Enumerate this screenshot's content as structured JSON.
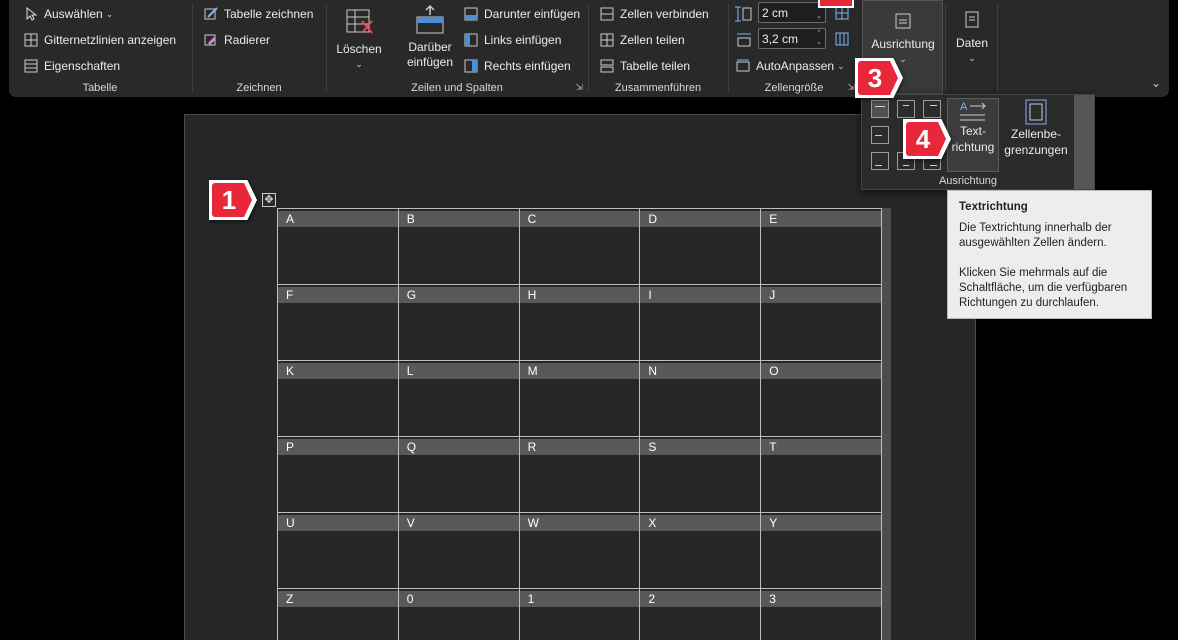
{
  "ribbon": {
    "tabelle": {
      "label": "Tabelle",
      "select": "Auswählen",
      "gridlines": "Gitternetzlinien anzeigen",
      "properties": "Eigenschaften"
    },
    "zeichnen": {
      "label": "Zeichnen",
      "draw_table": "Tabelle zeichnen",
      "eraser": "Radierer"
    },
    "zeilen_spalten": {
      "label": "Zeilen und Spalten",
      "delete": "Löschen",
      "insert_above_1": "Darüber",
      "insert_above_2": "einfügen",
      "insert_below": "Darunter einfügen",
      "insert_left": "Links einfügen",
      "insert_right": "Rechts einfügen"
    },
    "zusammenfuehren": {
      "label": "Zusammenführen",
      "merge": "Zellen verbinden",
      "split_cells": "Zellen teilen",
      "split_table": "Tabelle teilen"
    },
    "zellengroesse": {
      "label": "Zellengröße",
      "height": "2 cm",
      "width": "3,2 cm",
      "autofit": "AutoAnpassen"
    },
    "ausrichtung": {
      "label": "Ausrichtung"
    },
    "daten": {
      "label": "Daten"
    }
  },
  "dropdown": {
    "text_direction_1": "Text-",
    "text_direction_2": "richtung",
    "cell_margins_1": "Zellenbe-",
    "cell_margins_2": "grenzungen",
    "group_label": "Ausrichtung"
  },
  "tooltip": {
    "title": "Textrichtung",
    "line1": "Die Textrichtung innerhalb der ausgewählten Zellen ändern.",
    "line2": "Klicken Sie mehrmals auf die Schaltfläche, um die verfügbaren Richtungen zu durchlaufen."
  },
  "steps": [
    "1",
    "3",
    "4"
  ],
  "table": {
    "rows": [
      [
        "A",
        "B",
        "C",
        "D",
        "E"
      ],
      [
        "F",
        "G",
        "H",
        "I",
        "J"
      ],
      [
        "K",
        "L",
        "M",
        "N",
        "O"
      ],
      [
        "P",
        "Q",
        "R",
        "S",
        "T"
      ],
      [
        "U",
        "V",
        "W",
        "X",
        "Y"
      ],
      [
        "Z",
        "0",
        "1",
        "2",
        "3"
      ]
    ]
  },
  "colors": {
    "ribbon_bg": "#292929",
    "step_marker": "#e8283a",
    "header_shade": "#595959",
    "tooltip_bg": "#ededed"
  }
}
